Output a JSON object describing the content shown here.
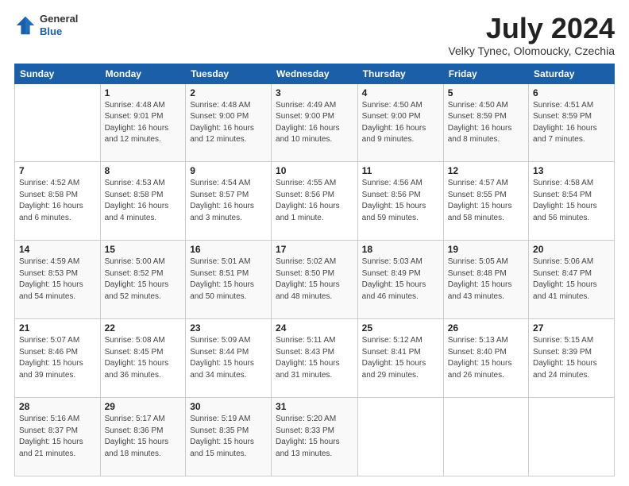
{
  "logo": {
    "general": "General",
    "blue": "Blue"
  },
  "header": {
    "month": "July 2024",
    "location": "Velky Tynec, Olomoucky, Czechia"
  },
  "weekdays": [
    "Sunday",
    "Monday",
    "Tuesday",
    "Wednesday",
    "Thursday",
    "Friday",
    "Saturday"
  ],
  "weeks": [
    [
      {
        "day": "",
        "info": ""
      },
      {
        "day": "1",
        "info": "Sunrise: 4:48 AM\nSunset: 9:01 PM\nDaylight: 16 hours\nand 12 minutes."
      },
      {
        "day": "2",
        "info": "Sunrise: 4:48 AM\nSunset: 9:00 PM\nDaylight: 16 hours\nand 12 minutes."
      },
      {
        "day": "3",
        "info": "Sunrise: 4:49 AM\nSunset: 9:00 PM\nDaylight: 16 hours\nand 10 minutes."
      },
      {
        "day": "4",
        "info": "Sunrise: 4:50 AM\nSunset: 9:00 PM\nDaylight: 16 hours\nand 9 minutes."
      },
      {
        "day": "5",
        "info": "Sunrise: 4:50 AM\nSunset: 8:59 PM\nDaylight: 16 hours\nand 8 minutes."
      },
      {
        "day": "6",
        "info": "Sunrise: 4:51 AM\nSunset: 8:59 PM\nDaylight: 16 hours\nand 7 minutes."
      }
    ],
    [
      {
        "day": "7",
        "info": "Sunrise: 4:52 AM\nSunset: 8:58 PM\nDaylight: 16 hours\nand 6 minutes."
      },
      {
        "day": "8",
        "info": "Sunrise: 4:53 AM\nSunset: 8:58 PM\nDaylight: 16 hours\nand 4 minutes."
      },
      {
        "day": "9",
        "info": "Sunrise: 4:54 AM\nSunset: 8:57 PM\nDaylight: 16 hours\nand 3 minutes."
      },
      {
        "day": "10",
        "info": "Sunrise: 4:55 AM\nSunset: 8:56 PM\nDaylight: 16 hours\nand 1 minute."
      },
      {
        "day": "11",
        "info": "Sunrise: 4:56 AM\nSunset: 8:56 PM\nDaylight: 15 hours\nand 59 minutes."
      },
      {
        "day": "12",
        "info": "Sunrise: 4:57 AM\nSunset: 8:55 PM\nDaylight: 15 hours\nand 58 minutes."
      },
      {
        "day": "13",
        "info": "Sunrise: 4:58 AM\nSunset: 8:54 PM\nDaylight: 15 hours\nand 56 minutes."
      }
    ],
    [
      {
        "day": "14",
        "info": "Sunrise: 4:59 AM\nSunset: 8:53 PM\nDaylight: 15 hours\nand 54 minutes."
      },
      {
        "day": "15",
        "info": "Sunrise: 5:00 AM\nSunset: 8:52 PM\nDaylight: 15 hours\nand 52 minutes."
      },
      {
        "day": "16",
        "info": "Sunrise: 5:01 AM\nSunset: 8:51 PM\nDaylight: 15 hours\nand 50 minutes."
      },
      {
        "day": "17",
        "info": "Sunrise: 5:02 AM\nSunset: 8:50 PM\nDaylight: 15 hours\nand 48 minutes."
      },
      {
        "day": "18",
        "info": "Sunrise: 5:03 AM\nSunset: 8:49 PM\nDaylight: 15 hours\nand 46 minutes."
      },
      {
        "day": "19",
        "info": "Sunrise: 5:05 AM\nSunset: 8:48 PM\nDaylight: 15 hours\nand 43 minutes."
      },
      {
        "day": "20",
        "info": "Sunrise: 5:06 AM\nSunset: 8:47 PM\nDaylight: 15 hours\nand 41 minutes."
      }
    ],
    [
      {
        "day": "21",
        "info": "Sunrise: 5:07 AM\nSunset: 8:46 PM\nDaylight: 15 hours\nand 39 minutes."
      },
      {
        "day": "22",
        "info": "Sunrise: 5:08 AM\nSunset: 8:45 PM\nDaylight: 15 hours\nand 36 minutes."
      },
      {
        "day": "23",
        "info": "Sunrise: 5:09 AM\nSunset: 8:44 PM\nDaylight: 15 hours\nand 34 minutes."
      },
      {
        "day": "24",
        "info": "Sunrise: 5:11 AM\nSunset: 8:43 PM\nDaylight: 15 hours\nand 31 minutes."
      },
      {
        "day": "25",
        "info": "Sunrise: 5:12 AM\nSunset: 8:41 PM\nDaylight: 15 hours\nand 29 minutes."
      },
      {
        "day": "26",
        "info": "Sunrise: 5:13 AM\nSunset: 8:40 PM\nDaylight: 15 hours\nand 26 minutes."
      },
      {
        "day": "27",
        "info": "Sunrise: 5:15 AM\nSunset: 8:39 PM\nDaylight: 15 hours\nand 24 minutes."
      }
    ],
    [
      {
        "day": "28",
        "info": "Sunrise: 5:16 AM\nSunset: 8:37 PM\nDaylight: 15 hours\nand 21 minutes."
      },
      {
        "day": "29",
        "info": "Sunrise: 5:17 AM\nSunset: 8:36 PM\nDaylight: 15 hours\nand 18 minutes."
      },
      {
        "day": "30",
        "info": "Sunrise: 5:19 AM\nSunset: 8:35 PM\nDaylight: 15 hours\nand 15 minutes."
      },
      {
        "day": "31",
        "info": "Sunrise: 5:20 AM\nSunset: 8:33 PM\nDaylight: 15 hours\nand 13 minutes."
      },
      {
        "day": "",
        "info": ""
      },
      {
        "day": "",
        "info": ""
      },
      {
        "day": "",
        "info": ""
      }
    ]
  ]
}
